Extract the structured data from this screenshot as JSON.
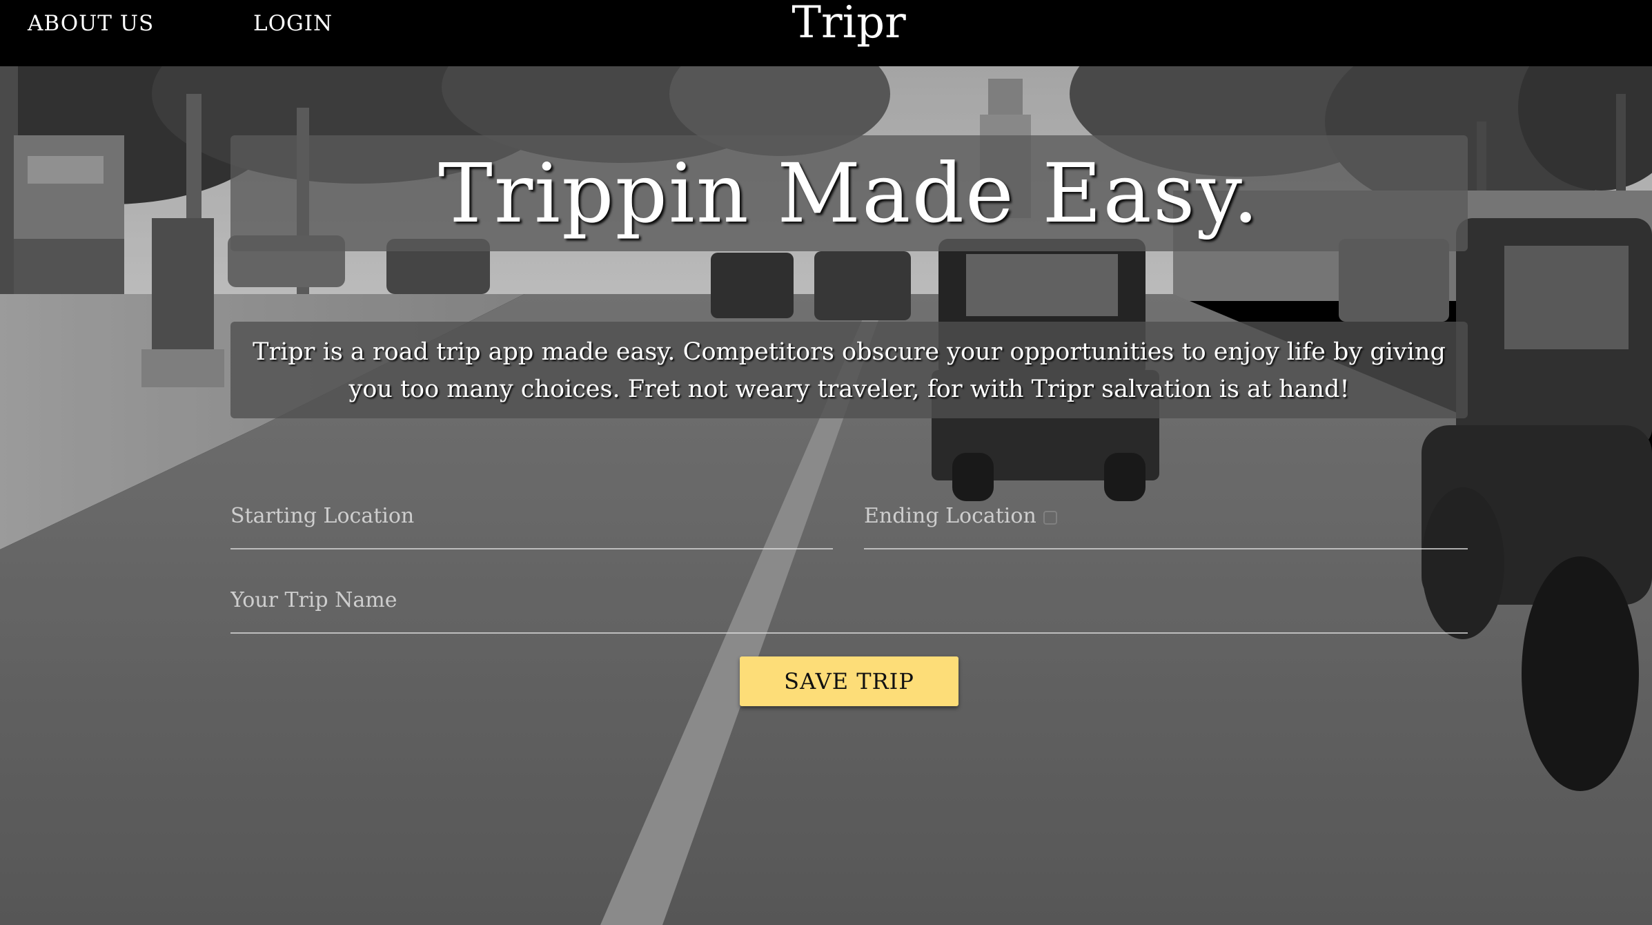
{
  "nav": {
    "about_label": "ABOUT US",
    "login_label": "LOGIN",
    "brand": "Tripr"
  },
  "hero": {
    "headline": "Trippin Made Easy.",
    "description": "Tripr is a road trip app made easy. Competitors obscure your opportunities to enjoy life by giving you too many choices. Fret not weary traveler, for with Tripr salvation is at hand!"
  },
  "form": {
    "start_placeholder": "Starting Location",
    "end_placeholder": "Ending Location",
    "trip_name_placeholder": "Your Trip Name",
    "save_label": "SAVE TRIP"
  },
  "colors": {
    "navbar_bg": "#000000",
    "button_bg": "#fddd78",
    "panel_bg": "rgba(90,90,90,0.78)"
  }
}
